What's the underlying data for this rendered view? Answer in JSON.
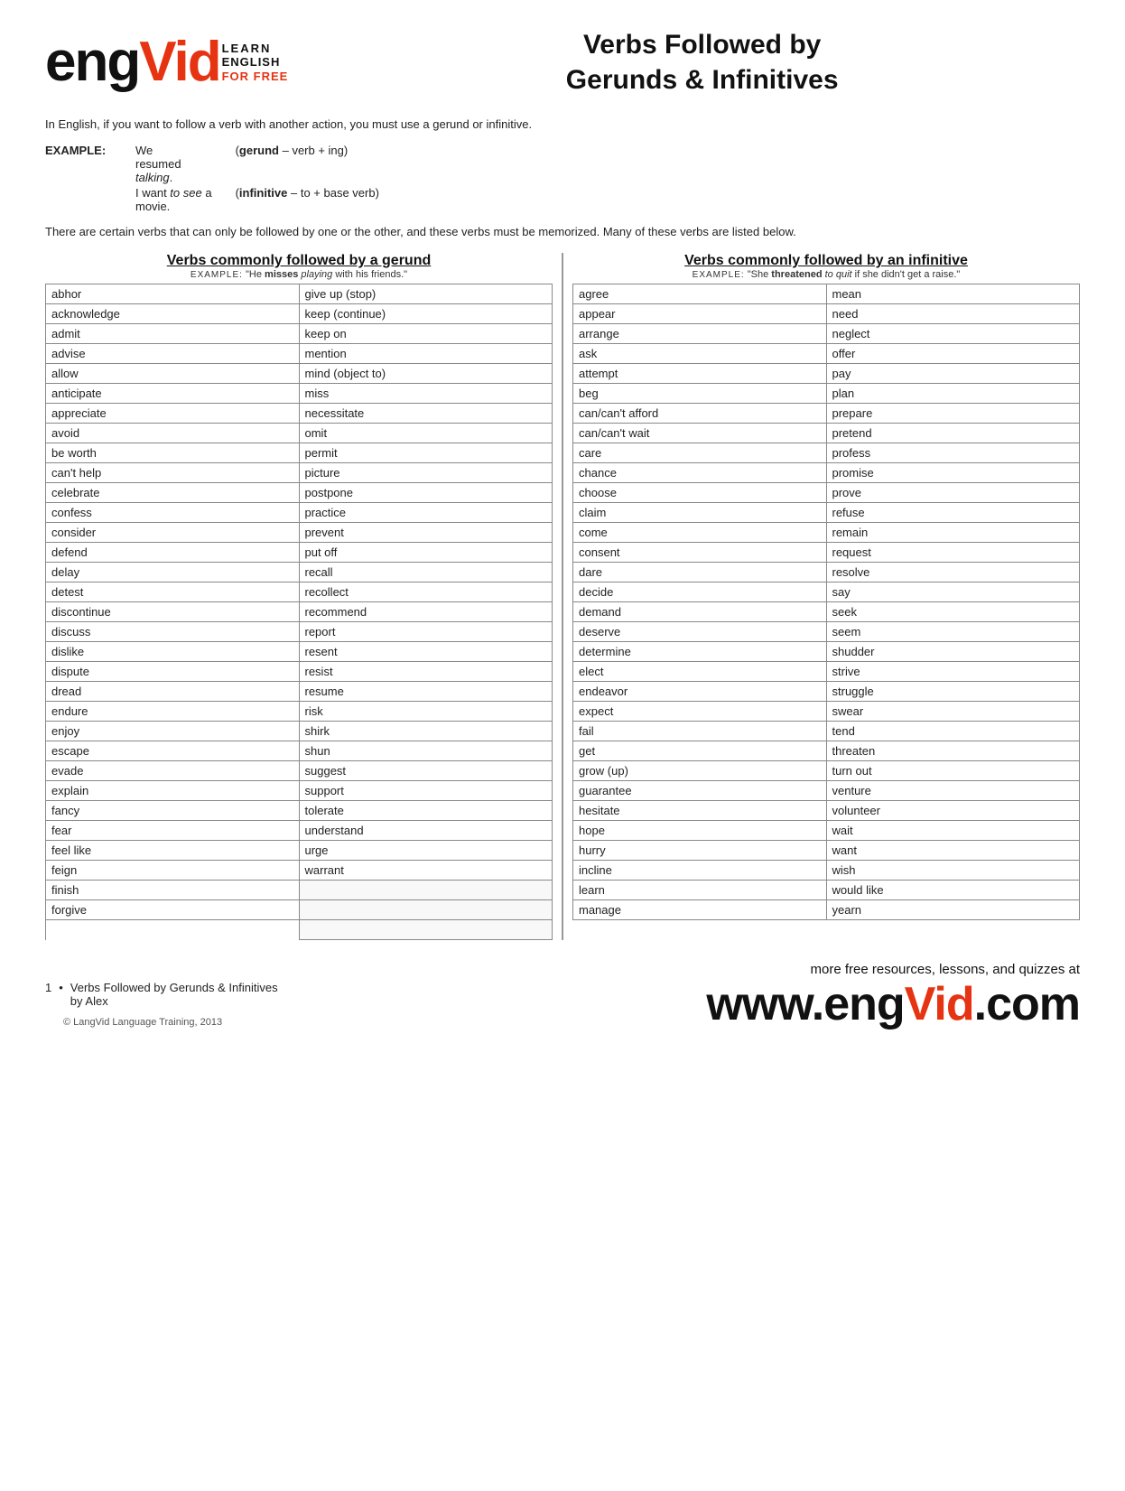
{
  "header": {
    "logo_eng": "eng",
    "logo_vid": "Vid",
    "logo_learn": "LEARN",
    "logo_english": "ENGLISH",
    "logo_forfree": "FOR FREE",
    "title_line1": "Verbs Followed by",
    "title_line2": "Gerunds & Infinitives"
  },
  "intro": {
    "paragraph1": "In English, if you want to follow a verb with another action, you must use a gerund or infinitive.",
    "example_label": "EXAMPLE:",
    "example1_sentence": "We resumed ",
    "example1_italic": "talking",
    "example1_def_label": "gerund",
    "example1_def": " – verb + ing",
    "example2_sentence": "I want ",
    "example2_italic": "to see",
    "example2_suffix": " a movie.",
    "example2_def_label": "infinitive",
    "example2_def": " – to + base verb",
    "paragraph2": "There are certain verbs that can only be followed by one or the other, and these verbs must be memorized. Many of these verbs are listed below."
  },
  "gerund_section": {
    "heading": "Verbs commonly followed by a gerund",
    "example_label": "EXAMPLE:",
    "example_pre": "\"He ",
    "example_bold": "misses",
    "example_italic": " playing",
    "example_post": " with his friends.\"",
    "col1": [
      "abhor",
      "acknowledge",
      "admit",
      "advise",
      "allow",
      "anticipate",
      "appreciate",
      "avoid",
      "be worth",
      "can't help",
      "celebrate",
      "confess",
      "consider",
      "defend",
      "delay",
      "detest",
      "discontinue",
      "discuss",
      "dislike",
      "dispute",
      "dread",
      "endure",
      "enjoy",
      "escape",
      "evade",
      "explain",
      "fancy",
      "fear",
      "feel like",
      "feign",
      "finish",
      "forgive"
    ],
    "col2": [
      "give up (stop)",
      "keep (continue)",
      "keep on",
      "mention",
      "mind (object to)",
      "miss",
      "necessitate",
      "omit",
      "permit",
      "picture",
      "postpone",
      "practice",
      "prevent",
      "put off",
      "recall",
      "recollect",
      "recommend",
      "report",
      "resent",
      "resist",
      "resume",
      "risk",
      "shirk",
      "shun",
      "suggest",
      "support",
      "tolerate",
      "understand",
      "urge",
      "warrant",
      "",
      "",
      ""
    ]
  },
  "infinitive_section": {
    "heading": "Verbs commonly followed by an infinitive",
    "example_label": "EXAMPLE:",
    "example_pre": "\"She ",
    "example_bold": "threatened",
    "example_italic": " to quit",
    "example_post": " if she didn't get a raise.\"",
    "col1": [
      "agree",
      "appear",
      "arrange",
      "ask",
      "attempt",
      "beg",
      "can/can't afford",
      "can/can't wait",
      "care",
      "chance",
      "choose",
      "claim",
      "come",
      "consent",
      "dare",
      "decide",
      "demand",
      "deserve",
      "determine",
      "elect",
      "endeavor",
      "expect",
      "fail",
      "get",
      "grow (up)",
      "guarantee",
      "hesitate",
      "hope",
      "hurry",
      "incline",
      "learn",
      "manage"
    ],
    "col2": [
      "mean",
      "need",
      "neglect",
      "offer",
      "pay",
      "plan",
      "prepare",
      "pretend",
      "profess",
      "promise",
      "prove",
      "refuse",
      "remain",
      "request",
      "resolve",
      "say",
      "seek",
      "seem",
      "shudder",
      "strive",
      "struggle",
      "swear",
      "tend",
      "threaten",
      "turn out",
      "venture",
      "volunteer",
      "wait",
      "want",
      "wish",
      "would like",
      "yearn"
    ]
  },
  "footer": {
    "lesson_number": "1",
    "bullet": "•",
    "lesson_title": "Verbs Followed by Gerunds & Infinitives",
    "lesson_by": "by Alex",
    "copyright": "© LangVid Language Training, 2013",
    "more_text": "more free resources, lessons, and quizzes at",
    "website": "www.engVid.com"
  }
}
